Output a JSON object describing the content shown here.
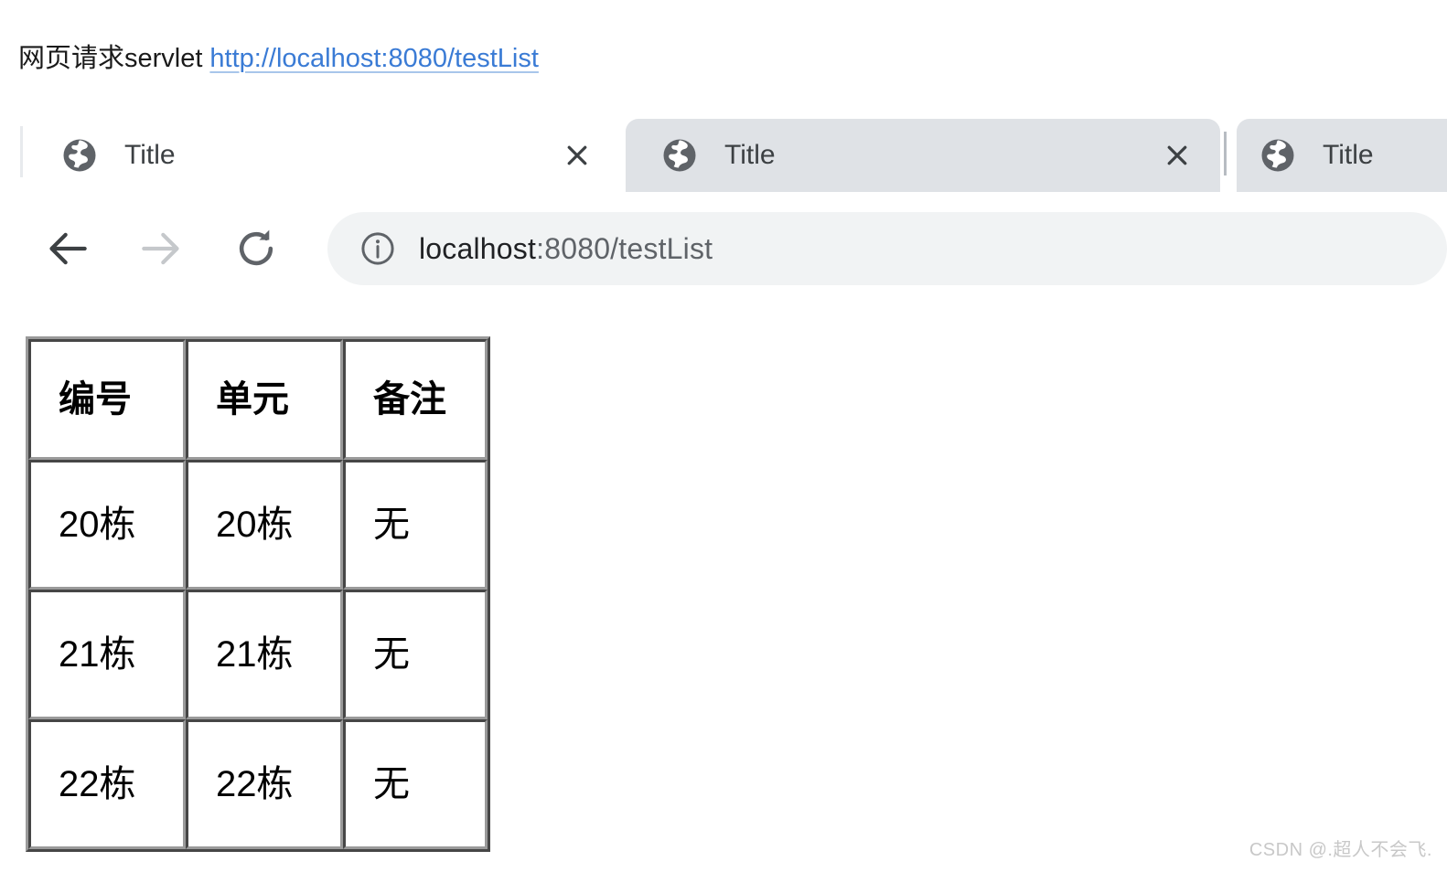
{
  "document": {
    "heading_text": "网页请求servlet",
    "heading_link": "http://localhost:8080/testList"
  },
  "browser": {
    "tabs": [
      {
        "title": "Title",
        "favicon": "globe-icon",
        "active": true,
        "close_label": "✕"
      },
      {
        "title": "Title",
        "favicon": "globe-icon",
        "active": false,
        "close_label": "✕"
      },
      {
        "title": "Title",
        "favicon": "globe-icon",
        "active": false,
        "close_label": ""
      }
    ],
    "toolbar": {
      "back_label": "back-arrow-icon",
      "forward_label": "forward-arrow-icon",
      "reload_label": "reload-icon",
      "omnibox": {
        "site_info_icon": "info-circle-icon",
        "url_host": "localhost",
        "url_rest": ":8080/testList",
        "full_url": "localhost:8080/testList"
      }
    }
  },
  "page": {
    "table": {
      "headers": [
        "编号",
        "单元",
        "备注"
      ],
      "rows": [
        [
          "20栋",
          "20栋",
          "无"
        ],
        [
          "21栋",
          "21栋",
          "无"
        ],
        [
          "22栋",
          "22栋",
          "无"
        ]
      ]
    }
  },
  "watermark": {
    "text": "CSDN @.超人不会飞."
  },
  "colors": {
    "link": "#3a7bd5",
    "tab_inactive_bg": "#dfe2e6",
    "omnibox_bg": "#f1f3f4",
    "text_primary": "#202124",
    "text_secondary": "#5f6368"
  }
}
